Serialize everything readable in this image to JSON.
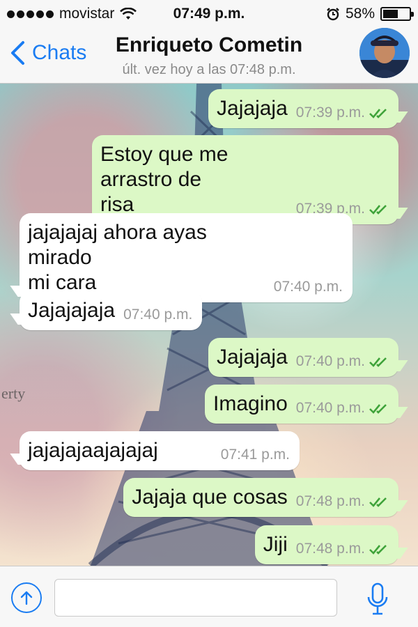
{
  "status_bar": {
    "carrier": "movistar",
    "time": "07:49 p.m.",
    "battery": "58%",
    "battery_level": 0.58
  },
  "header": {
    "back_label": "Chats",
    "contact_name": "Enriqueto Cometin",
    "last_seen": "últ. vez hoy a las 07:48 p.m."
  },
  "messages": [
    {
      "direction": "out",
      "lines": [
        "Jajajaja"
      ],
      "time": "07:39 p.m.",
      "read": true
    },
    {
      "direction": "out",
      "lines": [
        "Estoy que me arrastro de",
        "risa"
      ],
      "time": "07:39 p.m.",
      "read": true
    },
    {
      "direction": "in",
      "lines": [
        "jajajajaj ahora ayas mirado",
        "mi cara"
      ],
      "time": "07:40 p.m."
    },
    {
      "direction": "in",
      "lines": [
        "Jajajajaja"
      ],
      "time": "07:40 p.m."
    },
    {
      "direction": "out",
      "lines": [
        "Jajajaja"
      ],
      "time": "07:40 p.m.",
      "read": true
    },
    {
      "direction": "out",
      "lines": [
        "Imagino"
      ],
      "time": "07:40 p.m.",
      "read": true
    },
    {
      "direction": "in",
      "lines": [
        "jajajajaajajajaj"
      ],
      "time": "07:41 p.m."
    },
    {
      "direction": "out",
      "lines": [
        "Jajaja que cosas"
      ],
      "time": "07:48 p.m.",
      "read": true
    },
    {
      "direction": "out",
      "lines": [
        "Jiji"
      ],
      "time": "07:48 p.m.",
      "read": true
    }
  ],
  "wallpaper_watermark": "erty",
  "input": {
    "value": "",
    "placeholder": ""
  },
  "colors": {
    "accent": "#1a7cf2",
    "outgoing_bubble": "#dcf8c6",
    "incoming_bubble": "#ffffff",
    "read_ticks": "#3fa33a"
  },
  "icons": {
    "attach": "upload-arrow-icon",
    "mic": "microphone-icon",
    "back": "chevron-left-icon"
  }
}
